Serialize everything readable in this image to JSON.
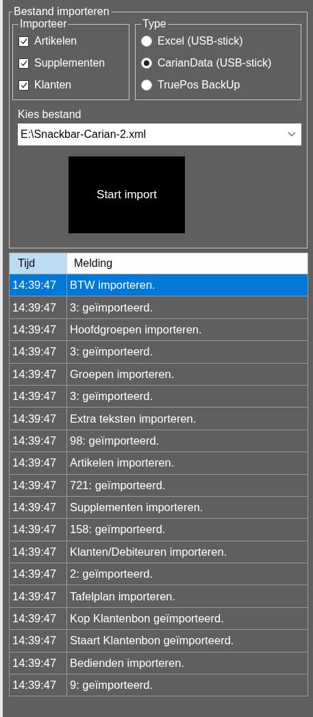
{
  "group": {
    "title": "Bestand importeren",
    "importeer": {
      "title": "Importeer",
      "items": [
        {
          "label": "Artikelen",
          "checked": true
        },
        {
          "label": "Supplementen",
          "checked": true
        },
        {
          "label": "Klanten",
          "checked": true
        }
      ]
    },
    "type": {
      "title": "Type",
      "items": [
        {
          "label": "Excel (USB-stick)",
          "selected": false
        },
        {
          "label": "CarianData (USB-stick)",
          "selected": true
        },
        {
          "label": "TruePos BackUp",
          "selected": false
        }
      ]
    },
    "file_label": "Kies bestand",
    "file_value": "E:\\Snackbar-Carian-2.xml",
    "start_button": "Start import"
  },
  "log": {
    "columns": [
      "Tijd",
      "Melding"
    ],
    "rows": [
      {
        "time": "14:39:47",
        "message": "BTW importeren.",
        "selected": true
      },
      {
        "time": "14:39:47",
        "message": "3: geïmporteerd.",
        "selected": false
      },
      {
        "time": "14:39:47",
        "message": "Hoofdgroepen importeren.",
        "selected": false
      },
      {
        "time": "14:39:47",
        "message": "3: geïmporteerd.",
        "selected": false
      },
      {
        "time": "14:39:47",
        "message": "Groepen importeren.",
        "selected": false
      },
      {
        "time": "14:39:47",
        "message": "3: geïmporteerd.",
        "selected": false
      },
      {
        "time": "14:39:47",
        "message": "Extra teksten importeren.",
        "selected": false
      },
      {
        "time": "14:39:47",
        "message": "98: geïmporteerd.",
        "selected": false
      },
      {
        "time": "14:39:47",
        "message": "Artikelen importeren.",
        "selected": false
      },
      {
        "time": "14:39:47",
        "message": "721: geïmporteerd.",
        "selected": false
      },
      {
        "time": "14:39:47",
        "message": "Supplementen importeren.",
        "selected": false
      },
      {
        "time": "14:39:47",
        "message": "158: geïmporteerd.",
        "selected": false
      },
      {
        "time": "14:39:47",
        "message": "Klanten/Debiteuren importeren.",
        "selected": false
      },
      {
        "time": "14:39:47",
        "message": "2: geïmporteerd.",
        "selected": false
      },
      {
        "time": "14:39:47",
        "message": "Tafelplan importeren.",
        "selected": false
      },
      {
        "time": "14:39:47",
        "message": "Kop Klantenbon geïmporteerd.",
        "selected": false
      },
      {
        "time": "14:39:47",
        "message": "Staart Klantenbon geïmporteerd.",
        "selected": false
      },
      {
        "time": "14:39:47",
        "message": "Bedienden importeren.",
        "selected": false
      },
      {
        "time": "14:39:47",
        "message": "9: geïmporteerd.",
        "selected": false
      }
    ]
  }
}
